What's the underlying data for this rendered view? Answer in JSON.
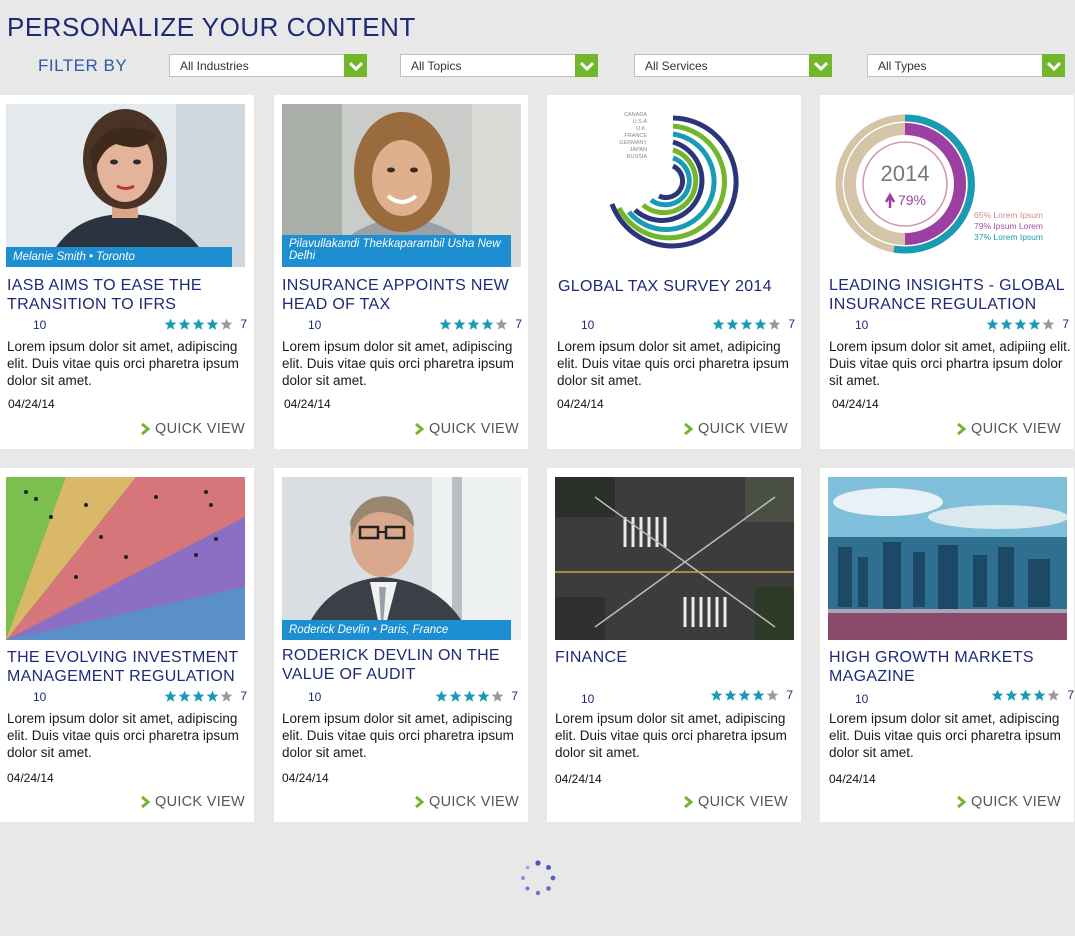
{
  "header": {
    "title": "PERSONALIZE YOUR CONTENT",
    "filter_label": "FILTER BY"
  },
  "filters": [
    {
      "value": "All Industries",
      "icon": "chevron-down-icon"
    },
    {
      "value": "All Topics",
      "icon": "chevron-down-icon"
    },
    {
      "value": "All Services",
      "icon": "chevron-down-icon"
    },
    {
      "value": "All Types",
      "icon": "chevron-down-icon"
    }
  ],
  "colors": {
    "brand_blue": "#1e2a78",
    "accent_green": "#72b62b",
    "star_teal": "#1a9bb5",
    "caption_blue": "#1d8fd0"
  },
  "cards": [
    {
      "title": "IASB AIMS TO EASE THE TRANSITION TO IFRS",
      "caption": "Melanie Smith • Toronto",
      "count": "10",
      "rating": 4,
      "rating_count": "7",
      "description": "Lorem ipsum dolor sit amet, adipiscing elit. Duis vitae quis orci pharetra ipsum dolor sit amet.",
      "date": "04/24/14",
      "quick_view": "QUICK VIEW"
    },
    {
      "title": "INSURANCE APPOINTS NEW HEAD OF TAX",
      "caption": "Pilavullakandi Thekkaparambil Usha New Delhi",
      "count": "10",
      "rating": 4,
      "rating_count": "7",
      "description": "Lorem ipsum dolor sit amet, adipiscing elit. Duis vitae quis orci pharetra ipsum dolor sit amet.",
      "date": "04/24/14",
      "quick_view": "QUICK VIEW"
    },
    {
      "title": "GLOBAL TAX SURVEY 2014",
      "caption": "",
      "chart_labels": [
        "CANADA",
        "U.S.A",
        "U.K.",
        "FRANCE",
        "GERMANY",
        "JAPAN",
        "RUSSIA"
      ],
      "count": "10",
      "rating": 4,
      "rating_count": "7",
      "description": "Lorem ipsum dolor sit amet, adipicing elit. Duis vitae quis orci pharetra ipsum dolor sit amet.",
      "date": "04/24/14",
      "quick_view": "QUICK VIEW"
    },
    {
      "title": "LEADING INSIGHTS - GLOBAL INSURANCE REGULATION",
      "caption": "",
      "donut": {
        "year": "2014",
        "value": "79%",
        "legend": [
          "65% Lorem Ipsum",
          "79% Ipsum Lorem",
          "37% Lorem Ipsum"
        ]
      },
      "count": "10",
      "rating": 4,
      "rating_count": "7",
      "description": "Lorem ipsum dolor sit amet, adipiing elit. Duis vitae quis orci phartra ipsum dolor sit amet.",
      "date": "04/24/14",
      "quick_view": "QUICK VIEW"
    },
    {
      "title": "THE EVOLVING INVESTMENT MANAGEMENT REGULATION",
      "caption": "",
      "count": "10",
      "rating": 4,
      "rating_count": "7",
      "description": "Lorem ipsum dolor sit amet, adipiscing elit. Duis vitae quis orci pharetra ipsum dolor sit amet.",
      "date": "04/24/14",
      "quick_view": "QUICK VIEW"
    },
    {
      "title": "RODERICK DEVLIN ON THE VALUE OF AUDIT",
      "caption": "Roderick Devlin • Paris, France",
      "count": "10",
      "rating": 4,
      "rating_count": "7",
      "description": "Lorem ipsum dolor sit amet, adipiscing elit. Duis vitae quis orci pharetra ipsum dolor sit amet.",
      "date": "04/24/14",
      "quick_view": "QUICK VIEW"
    },
    {
      "title": "FINANCE",
      "caption": "",
      "count": "10",
      "rating": 4,
      "rating_count": "7",
      "description": "Lorem ipsum dolor sit amet, adipiscing elit. Duis vitae quis orci pharetra ipsum dolor sit amet.",
      "date": "04/24/14",
      "quick_view": "QUICK VIEW"
    },
    {
      "title": "HIGH GROWTH MARKETS MAGAZINE",
      "caption": "",
      "count": "10",
      "rating": 4,
      "rating_count": "7",
      "description": "Lorem ipsum dolor sit amet, adipiscing elit. Duis vitae quis orci pharetra ipsum dolor sit amet.",
      "date": "04/24/14",
      "quick_view": "QUICK VIEW"
    }
  ],
  "loading": {
    "icon": "loading-spinner-icon"
  }
}
